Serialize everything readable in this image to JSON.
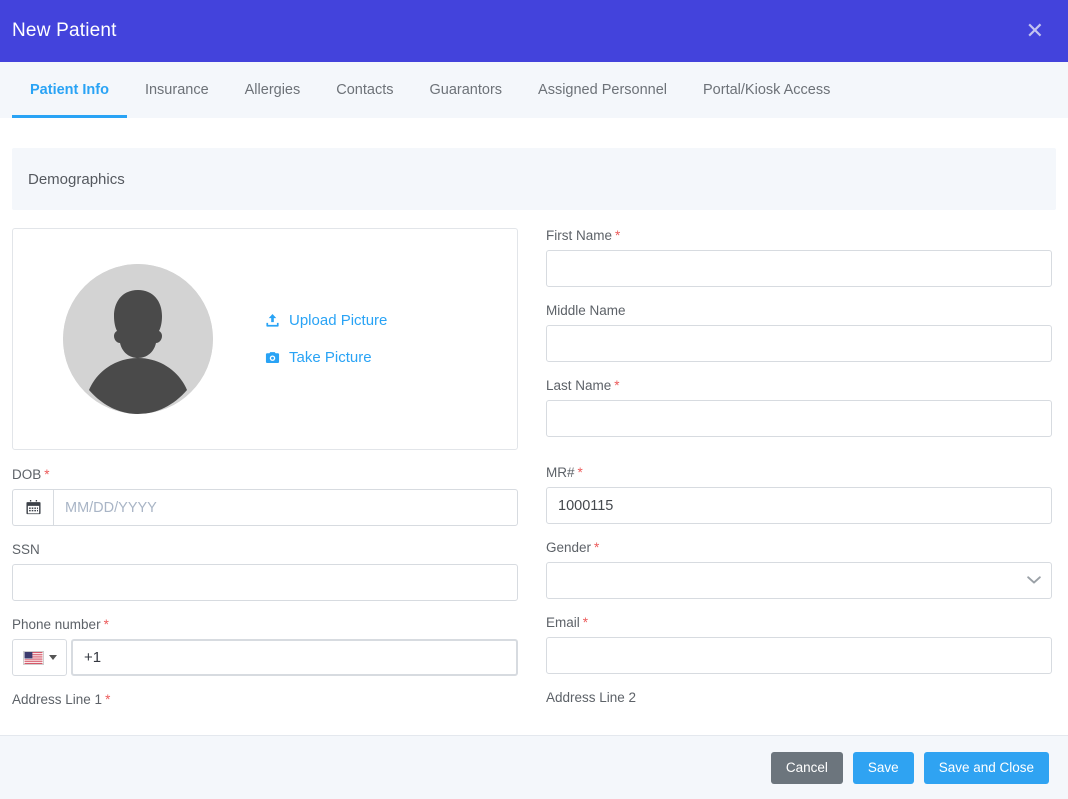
{
  "header": {
    "title": "New Patient",
    "close_icon": "close-icon",
    "close_glyph": "✕",
    "bg_color": "#4343DC"
  },
  "tabs": {
    "active_index": 0,
    "accent_color": "#29A3F5",
    "items": [
      {
        "label": "Patient Info"
      },
      {
        "label": "Insurance"
      },
      {
        "label": "Allergies"
      },
      {
        "label": "Contacts"
      },
      {
        "label": "Guarantors"
      },
      {
        "label": "Assigned Personnel"
      },
      {
        "label": "Portal/Kiosk Access"
      }
    ]
  },
  "section": {
    "title": "Demographics",
    "bg_color": "#F4F7FB"
  },
  "photo": {
    "avatar_icon": "user-avatar-placeholder",
    "avatar_bg": "#D3D3D3",
    "avatar_fg": "#4A4A4A",
    "upload_label": "Upload Picture",
    "upload_icon": "upload-icon",
    "take_label": "Take Picture",
    "take_icon": "camera-icon",
    "link_color": "#29A3F5"
  },
  "fields": {
    "first_name": {
      "label": "First Name",
      "required": true,
      "value": "",
      "placeholder": ""
    },
    "middle_name": {
      "label": "Middle Name",
      "required": false,
      "value": "",
      "placeholder": ""
    },
    "last_name": {
      "label": "Last Name",
      "required": true,
      "value": "",
      "placeholder": ""
    },
    "dob": {
      "label": "DOB",
      "required": true,
      "value": "",
      "placeholder": "MM/DD/YYYY",
      "icon": "calendar-icon"
    },
    "mrn": {
      "label": "MR#",
      "required": true,
      "value": "1000115",
      "placeholder": ""
    },
    "ssn": {
      "label": "SSN",
      "required": false,
      "value": "",
      "placeholder": ""
    },
    "gender": {
      "label": "Gender",
      "required": true,
      "value": "",
      "icon": "chevron-down-icon",
      "options": [
        ""
      ]
    },
    "phone": {
      "label": "Phone number",
      "required": true,
      "value": "+1",
      "placeholder": "",
      "country_flag": "us-flag-icon",
      "country_caret": "chevron-down-icon"
    },
    "email": {
      "label": "Email",
      "required": true,
      "value": "",
      "placeholder": ""
    },
    "address_line_1": {
      "label": "Address Line 1",
      "required": true
    },
    "address_line_2": {
      "label": "Address Line 2",
      "required": false
    }
  },
  "footer": {
    "cancel_label": "Cancel",
    "save_label": "Save",
    "save_close_label": "Save and Close",
    "cancel_color": "#6C757D",
    "primary_color": "#2FA3F2"
  },
  "required_marker": "*"
}
